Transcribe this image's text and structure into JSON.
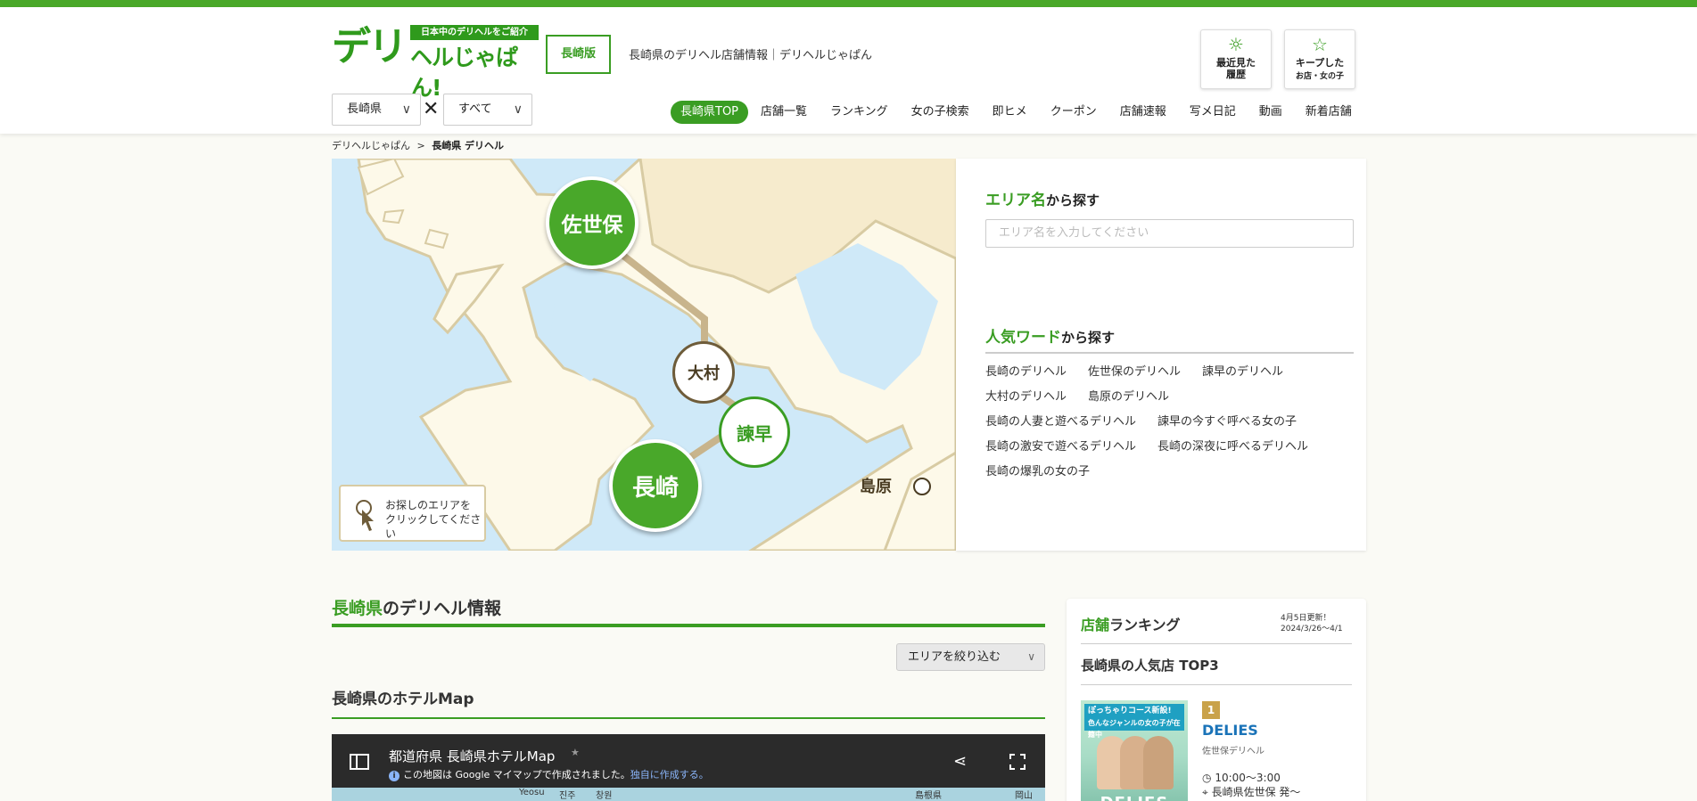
{
  "header": {
    "logo_main": "デリ",
    "logo_sub": "日本中のデリヘルをご紹介",
    "logo_tail": "ヘルじゃぱん!",
    "edition": "長崎版",
    "tagline": "長崎県のデリヘル店舗情報｜デリヘルじゃぱん",
    "history_label": "最近見た\n履歴",
    "keep_label": "キープした",
    "keep_sub": "お店・女の子",
    "prefecture_select": "長崎県",
    "category_select": "すべて",
    "nav": [
      "長崎県TOP",
      "店舗一覧",
      "ランキング",
      "女の子検索",
      "即ヒメ",
      "クーポン",
      "店舗速報",
      "写メ日記",
      "動画",
      "新着店舗"
    ]
  },
  "breadcrumb": {
    "home": "デリヘルじゃぱん",
    "sep": ">",
    "current": "長崎県 デリヘル"
  },
  "map": {
    "cities": {
      "sasebo": "佐世保",
      "omura": "大村",
      "isahaya": "諫早",
      "nagasaki": "長崎",
      "shimabara": "島原"
    },
    "hint_line1": "お探しのエリアを",
    "hint_line2": "クリックしてください"
  },
  "search": {
    "area_title_green": "エリア名",
    "area_title_rest": "から探す",
    "area_placeholder": "エリア名を入力してください",
    "popular_title_green": "人気ワード",
    "popular_title_rest": "から探す",
    "words": [
      [
        "長崎のデリヘル",
        "佐世保のデリヘル",
        "諫早のデリヘル"
      ],
      [
        "大村のデリヘル",
        "島原のデリヘル"
      ],
      [
        "長崎の人妻と遊べるデリヘル",
        "諫早の今すぐ呼べる女の子"
      ],
      [
        "長崎の激安で遊べるデリヘル",
        "長崎の深夜に呼べるデリヘル"
      ],
      [
        "長崎の爆乳の女の子"
      ]
    ]
  },
  "info": {
    "title_green": "長崎県",
    "title_rest": "のデリヘル情報",
    "filter_label": "エリアを絞り込む",
    "hotel_title": "長崎県のホテルMap"
  },
  "gmap": {
    "title": "都道府県 長崎県ホテルMap",
    "note": "この地図は Google マイマップで作成されました。",
    "note_link": "独自に作成する。",
    "labels": [
      "Yeosu",
      "진주",
      "창원",
      "島根県",
      "岡山"
    ]
  },
  "ranking": {
    "title_green": "店舗",
    "title_rest": "ランキング",
    "updated": "4月5日更新！",
    "period": "2024/3/26〜4/1",
    "subtitle": "長崎県の人気店 TOP3",
    "rank1": {
      "rank": "1",
      "name": "DELIES",
      "type": "佐世保デリヘル",
      "hours": "10:00〜3:00",
      "location": "長崎県佐世保 発〜",
      "banner1": "ぽっちゃりコース新設!",
      "banner2": "色んなジャンルの女の子が在籍中",
      "brand": "DELIES"
    }
  },
  "colors": {
    "brand_green": "#3a9d23",
    "link_blue": "#1a73b8",
    "map_sea": "#cfe9f8",
    "map_land": "#fdf9e9"
  }
}
